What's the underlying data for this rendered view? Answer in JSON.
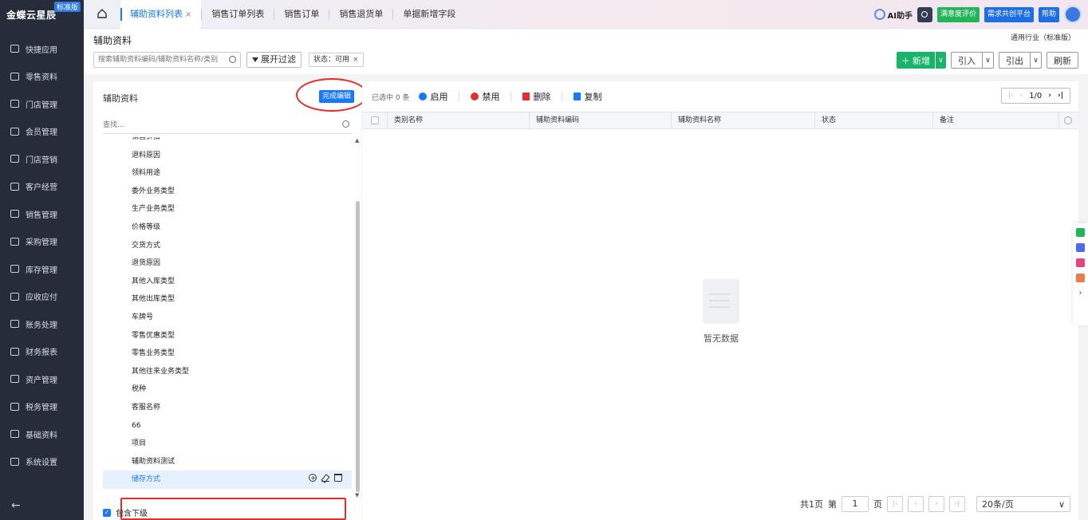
{
  "app": {
    "logo_text": "金蝶云星辰",
    "edition_badge": "标准版"
  },
  "sidebar": {
    "items": [
      {
        "label": "快捷应用",
        "icon": "grid-icon"
      },
      {
        "label": "零售资料",
        "icon": "basket-icon"
      },
      {
        "label": "门店管理",
        "icon": "store-icon"
      },
      {
        "label": "会员管理",
        "icon": "diamond-icon"
      },
      {
        "label": "门店营销",
        "icon": "tag-icon"
      },
      {
        "label": "客户经营",
        "icon": "user-icon"
      },
      {
        "label": "销售管理",
        "icon": "chart-icon"
      },
      {
        "label": "采购管理",
        "icon": "cart-icon"
      },
      {
        "label": "库存管理",
        "icon": "cube-icon"
      },
      {
        "label": "应收应付",
        "icon": "coin-icon"
      },
      {
        "label": "账务处理",
        "icon": "ledger-icon"
      },
      {
        "label": "财务报表",
        "icon": "report-icon"
      },
      {
        "label": "资产管理",
        "icon": "asset-icon"
      },
      {
        "label": "税务管理",
        "icon": "tax-icon"
      },
      {
        "label": "基础资料",
        "icon": "layers-icon"
      },
      {
        "label": "系统设置",
        "icon": "settings-icon"
      }
    ],
    "collapse_glyph": "←"
  },
  "tabs": [
    {
      "label": "辅助资料列表",
      "active": true,
      "close": "×"
    },
    {
      "label": "销售订单列表",
      "active": false
    },
    {
      "label": "销售订单",
      "active": false
    },
    {
      "label": "销售退货单",
      "active": false
    },
    {
      "label": "单据新增字段",
      "active": false
    }
  ],
  "topbar": {
    "ai_label": "AI助手",
    "satisfaction_label": "满意度评价",
    "demand_label": "需求共创平台",
    "help_label": "帮助"
  },
  "page": {
    "title": "辅助资料",
    "industry": "通用行业（标准版）",
    "search_placeholder": "搜索辅助资料编码/辅助资料名称/类别",
    "filter_label": "展开过滤",
    "status_chip": "状态：可用",
    "status_chip_close": "×",
    "new_label": "新增",
    "import_label": "引入",
    "export_label": "引出",
    "refresh_label": "刷新",
    "caret": "∨"
  },
  "tree": {
    "title": "辅助资料",
    "finish_edit_label": "完成编辑",
    "search_placeholder": "查找...",
    "items": [
      "销售折扣",
      "退料原因",
      "领料用途",
      "委外业务类型",
      "生产业务类型",
      "价格等级",
      "交货方式",
      "退货原因",
      "其他入库类型",
      "其他出库类型",
      "车牌号",
      "零售优惠类型",
      "零售业务类型",
      "其他往来业务类型",
      "税种",
      "客服名称",
      "66",
      "项目",
      "辅助资料测试",
      "储存方式"
    ],
    "selected_index": 19,
    "include_sub_label": "包含下级",
    "include_sub_checked": true
  },
  "grid": {
    "selected_text": "已选中 0 条",
    "actions": {
      "enable": "启用",
      "disable": "禁用",
      "delete": "删除",
      "copy": "复制"
    },
    "pager_text": "1/0",
    "columns": [
      "类别名称",
      "辅助资料编码",
      "辅助资料名称",
      "状态",
      "备注"
    ],
    "empty_text": "暂无数据",
    "footer": {
      "total_pages": "共1页",
      "page_prefix": "第",
      "page_value": "1",
      "page_suffix": "页",
      "page_size": "20条/页"
    }
  },
  "colors": {
    "sidebar_bg": "#262c3a",
    "accent": "#1677ff",
    "green": "#18b46a",
    "annotation_red": "#e62d2d"
  }
}
